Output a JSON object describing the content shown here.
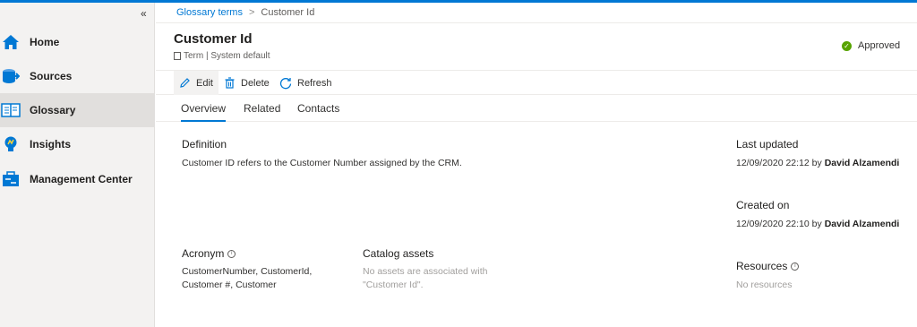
{
  "sidebar": {
    "collapse_label": "«",
    "items": [
      {
        "label": "Home",
        "icon": "home-icon"
      },
      {
        "label": "Sources",
        "icon": "sources-icon"
      },
      {
        "label": "Glossary",
        "icon": "glossary-icon",
        "active": true
      },
      {
        "label": "Insights",
        "icon": "insights-icon"
      },
      {
        "label": "Management Center",
        "icon": "management-icon"
      }
    ]
  },
  "breadcrumb": {
    "parent": "Glossary terms",
    "separator": ">",
    "current": "Customer Id"
  },
  "header": {
    "title": "Customer Id",
    "subtitle": "Term | System default",
    "status": "Approved",
    "status_color": "#57a300"
  },
  "toolbar": {
    "edit_label": "Edit",
    "delete_label": "Delete",
    "refresh_label": "Refresh"
  },
  "tabs": [
    {
      "label": "Overview",
      "active": true
    },
    {
      "label": "Related"
    },
    {
      "label": "Contacts"
    }
  ],
  "definition": {
    "label": "Definition",
    "text": "Customer ID refers to the Customer Number assigned by the CRM."
  },
  "acronym": {
    "label": "Acronym",
    "line1": "CustomerNumber, CustomerId,",
    "line2": "Customer #, Customer"
  },
  "catalog_assets": {
    "label": "Catalog assets",
    "line1": "No assets are associated with",
    "line2": "\"Customer Id\"."
  },
  "last_updated": {
    "label": "Last updated",
    "date": "12/09/2020 22:12 by",
    "user": "David Alzamendi"
  },
  "created_on": {
    "label": "Created on",
    "date": "12/09/2020 22:10 by",
    "user": "David Alzamendi"
  },
  "resources": {
    "label": "Resources",
    "value": "No resources"
  },
  "colors": {
    "accent": "#0078d4",
    "sidebar_bg": "#f3f2f1"
  }
}
